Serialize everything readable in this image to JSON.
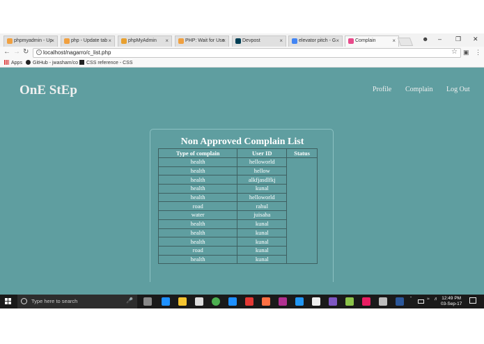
{
  "browser": {
    "tabs": [
      {
        "label": "phpmyadmin - Up",
        "favicon_color": "#f0a040"
      },
      {
        "label": "php - Update tab",
        "favicon_color": "#f0a040"
      },
      {
        "label": "phpMyAdmin",
        "favicon_color": "#e8a030"
      },
      {
        "label": "PHP: Wait for Use",
        "favicon_color": "#f0a040"
      },
      {
        "label": "Devpost",
        "favicon_color": "#003e54"
      },
      {
        "label": "elevator pitch - G",
        "favicon_color": "#4285f4"
      },
      {
        "label": "Complain",
        "favicon_color": "#e84a8a"
      }
    ],
    "active_tab_index": 6,
    "url": "localhost/nagarro/c_list.php",
    "bookmarks": [
      {
        "label": "Apps",
        "icon": "apps-grid-icon"
      },
      {
        "label": "GitHub - jwasham/co",
        "icon": "github-icon"
      },
      {
        "label": "CSS reference - CSS",
        "icon": "mdn-icon"
      }
    ]
  },
  "site": {
    "brand": "OnE StEp",
    "nav": [
      "Profile",
      "Complain",
      "Log Out"
    ]
  },
  "panel": {
    "title": "Non Approved Complain List",
    "columns": [
      "Type of complain",
      "User ID",
      "Status"
    ],
    "rows": [
      {
        "type": "health",
        "user": "helloworld"
      },
      {
        "type": "health",
        "user": "hellow"
      },
      {
        "type": "health",
        "user": "alkfjasdlfkj"
      },
      {
        "type": "health",
        "user": "kunal"
      },
      {
        "type": "health",
        "user": "helloworld"
      },
      {
        "type": "road",
        "user": "rahul"
      },
      {
        "type": "water",
        "user": "juisaha"
      },
      {
        "type": "health",
        "user": "kunal"
      },
      {
        "type": "health",
        "user": "kunal"
      },
      {
        "type": "health",
        "user": "kunal"
      },
      {
        "type": "road",
        "user": "kunal"
      },
      {
        "type": "health",
        "user": "kunal"
      }
    ]
  },
  "taskbar": {
    "search_placeholder": "Type here to search",
    "time": "12:49 PM",
    "date": "03-Sep-17",
    "pinned": [
      {
        "icon": "task-view-icon",
        "color": "#888888"
      },
      {
        "icon": "edge-icon",
        "color": "#1e90ff"
      },
      {
        "icon": "file-explorer-icon",
        "color": "#f4c430"
      },
      {
        "icon": "store-icon",
        "color": "#dddddd"
      },
      {
        "icon": "chrome-icon",
        "color": "#4caf50"
      },
      {
        "icon": "media-player-icon",
        "color": "#1e90ff"
      },
      {
        "icon": "app-icon",
        "color": "#e53935"
      },
      {
        "icon": "app-icon",
        "color": "#ff7043"
      },
      {
        "icon": "phpstorm-icon",
        "color": "#b03090"
      },
      {
        "icon": "app-icon",
        "color": "#2196f3"
      },
      {
        "icon": "mail-icon",
        "color": "#eeeeee"
      },
      {
        "icon": "visual-studio-icon",
        "color": "#7e57c2"
      },
      {
        "icon": "app-icon",
        "color": "#8bc34a"
      },
      {
        "icon": "app-icon",
        "color": "#e91e63"
      },
      {
        "icon": "app-icon",
        "color": "#bdbdbd"
      },
      {
        "icon": "word-icon",
        "color": "#2b579a"
      }
    ]
  }
}
